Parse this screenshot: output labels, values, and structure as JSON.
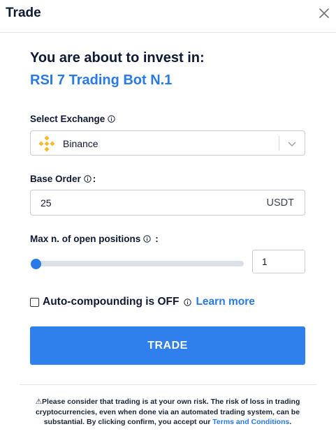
{
  "header": {
    "title": "Trade"
  },
  "intro": {
    "heading": "You are about to invest in:",
    "bot_name": "RSI 7 Trading Bot N.1"
  },
  "exchange": {
    "label": "Select Exchange",
    "selected": "Binance",
    "logo_icon": "binance-logo",
    "logo_color": "#f3ba2f"
  },
  "base_order": {
    "label": "Base Order",
    "label_suffix": ":",
    "value": "25",
    "unit": "USDT"
  },
  "positions": {
    "label": "Max n. of open positions",
    "label_suffix": ":",
    "value": "1",
    "slider_fraction": 0.0
  },
  "compound": {
    "label": "Auto-compounding is OFF",
    "learn_more": "Learn more",
    "checked": false
  },
  "trade_button": {
    "label": "TRADE"
  },
  "disclaimer": {
    "text": "⚠Please consider that trading is at your own risk. The risk of loss in trading cryptocurrencies, even when done via an automated trading system, can be substantial. By clicking confirm, you accept our ",
    "link": "Terms and Conditions",
    "end": "."
  },
  "colors": {
    "accent": "#2979e6",
    "button": "#2f80ed",
    "text": "#0e1a33",
    "border": "#c8ccd3"
  }
}
